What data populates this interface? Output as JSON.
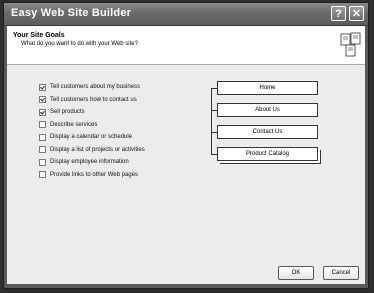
{
  "window": {
    "title": "Easy Web Site Builder",
    "help_label": "?",
    "close_label": "✕"
  },
  "header": {
    "title": "Your Site Goals",
    "subtitle": "What do you want to do with your Web site?",
    "icon": "web-pages-icon"
  },
  "goals": [
    {
      "label": "Tell customers about my business",
      "checked": true
    },
    {
      "label": "Tell customers how to contact us",
      "checked": true
    },
    {
      "label": "Sell products",
      "checked": true
    },
    {
      "label": "Describe services",
      "checked": false
    },
    {
      "label": "Display a calendar or schedule",
      "checked": false
    },
    {
      "label": "Display a list of projects or activities",
      "checked": false
    },
    {
      "label": "Display employee information",
      "checked": false
    },
    {
      "label": "Provide links to other Web pages",
      "checked": false
    }
  ],
  "site_pages": [
    "Home",
    "About Us",
    "Contact Us",
    "Product Catalog"
  ],
  "buttons": {
    "ok": "OK",
    "cancel": "Cancel"
  }
}
